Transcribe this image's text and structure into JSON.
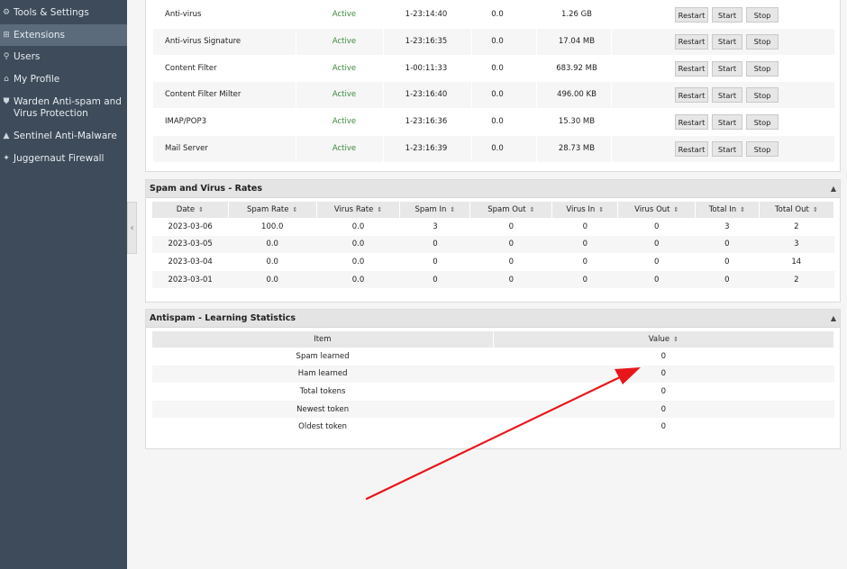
{
  "sidebar": {
    "items": [
      {
        "label": "Tools & Settings",
        "icon": "tools-icon"
      },
      {
        "label": "Extensions",
        "icon": "extensions-icon"
      },
      {
        "label": "Users",
        "icon": "user-icon"
      },
      {
        "label": "My Profile",
        "icon": "profile-icon"
      },
      {
        "label": "Warden Anti-spam and Virus Protection",
        "icon": "shield-icon"
      },
      {
        "label": "Sentinel Anti-Malware",
        "icon": "sentinel-icon"
      },
      {
        "label": "Juggernaut Firewall",
        "icon": "firewall-icon"
      }
    ]
  },
  "services": {
    "rows": [
      {
        "name": "Anti-virus",
        "status": "Active",
        "uptime": "1-23:14:40",
        "cpu": "0.0",
        "mem": "1.26 GB"
      },
      {
        "name": "Anti-virus Signature",
        "status": "Active",
        "uptime": "1-23:16:35",
        "cpu": "0.0",
        "mem": "17.04 MB"
      },
      {
        "name": "Content Filter",
        "status": "Active",
        "uptime": "1-00:11:33",
        "cpu": "0.0",
        "mem": "683.92 MB"
      },
      {
        "name": "Content Filter Milter",
        "status": "Active",
        "uptime": "1-23:16:40",
        "cpu": "0.0",
        "mem": "496.00 KB"
      },
      {
        "name": "IMAP/POP3",
        "status": "Active",
        "uptime": "1-23:16:36",
        "cpu": "0.0",
        "mem": "15.30 MB"
      },
      {
        "name": "Mail Server",
        "status": "Active",
        "uptime": "1-23:16:39",
        "cpu": "0.0",
        "mem": "28.73 MB"
      }
    ],
    "restart_label": "Restart",
    "start_label": "Start",
    "stop_label": "Stop"
  },
  "rates": {
    "title": "Spam and Virus - Rates",
    "columns": [
      "Date",
      "Spam Rate",
      "Virus Rate",
      "Spam In",
      "Spam Out",
      "Virus In",
      "Virus Out",
      "Total In",
      "Total Out"
    ],
    "rows": [
      [
        "2023-03-06",
        "100.0",
        "0.0",
        "3",
        "0",
        "0",
        "0",
        "3",
        "2"
      ],
      [
        "2023-03-05",
        "0.0",
        "0.0",
        "0",
        "0",
        "0",
        "0",
        "0",
        "3"
      ],
      [
        "2023-03-04",
        "0.0",
        "0.0",
        "0",
        "0",
        "0",
        "0",
        "0",
        "14"
      ],
      [
        "2023-03-01",
        "0.0",
        "0.0",
        "0",
        "0",
        "0",
        "0",
        "0",
        "2"
      ]
    ]
  },
  "learning": {
    "title": "Antispam - Learning Statistics",
    "columns": [
      "Item",
      "Value"
    ],
    "rows": [
      [
        "Spam learned",
        "0"
      ],
      [
        "Ham learned",
        "0"
      ],
      [
        "Total tokens",
        "0"
      ],
      [
        "Newest token",
        "0"
      ],
      [
        "Oldest token",
        "0"
      ]
    ]
  },
  "colors": {
    "sidebar_bg": "#3d4b5a",
    "sidebar_active": "#5b6b7c",
    "status_active": "#3b8a3e",
    "annotation_arrow": "#e8161b"
  }
}
